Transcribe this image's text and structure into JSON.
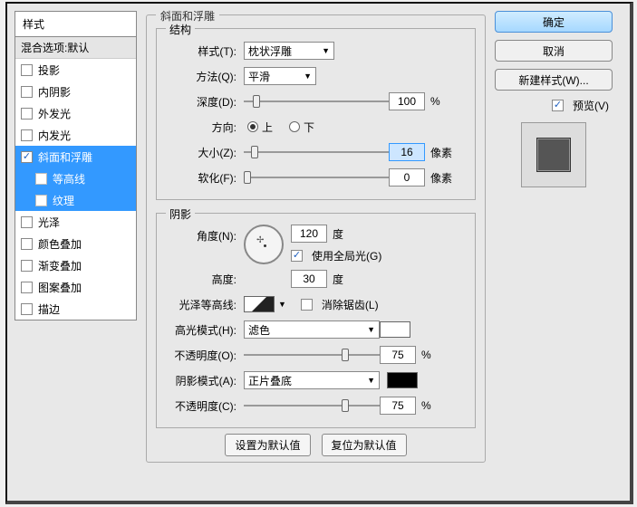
{
  "left": {
    "header": "样式",
    "blend_options": "混合选项:默认",
    "items": [
      {
        "label": "投影",
        "checked": false
      },
      {
        "label": "内阴影",
        "checked": false
      },
      {
        "label": "外发光",
        "checked": false
      },
      {
        "label": "内发光",
        "checked": false
      },
      {
        "label": "斜面和浮雕",
        "checked": true,
        "selected": true
      },
      {
        "label": "等高线",
        "checked": false,
        "selected": true,
        "sub": true
      },
      {
        "label": "纹理",
        "checked": false,
        "selected": true,
        "sub": true
      },
      {
        "label": "光泽",
        "checked": false
      },
      {
        "label": "颜色叠加",
        "checked": false
      },
      {
        "label": "渐变叠加",
        "checked": false
      },
      {
        "label": "图案叠加",
        "checked": false
      },
      {
        "label": "描边",
        "checked": false
      }
    ]
  },
  "mid": {
    "title": "斜面和浮雕",
    "structure": {
      "legend": "结构",
      "style_label": "样式(T):",
      "style_value": "枕状浮雕",
      "method_label": "方法(Q):",
      "method_value": "平滑",
      "depth_label": "深度(D):",
      "depth_value": "100",
      "depth_unit": "%",
      "direction_label": "方向:",
      "dir_up": "上",
      "dir_down": "下",
      "size_label": "大小(Z):",
      "size_value": "16",
      "size_unit": "像素",
      "soften_label": "软化(F):",
      "soften_value": "0",
      "soften_unit": "像素"
    },
    "shading": {
      "legend": "阴影",
      "angle_label": "角度(N):",
      "angle_value": "120",
      "angle_unit": "度",
      "global_light": "使用全局光(G)",
      "altitude_label": "高度:",
      "altitude_value": "30",
      "altitude_unit": "度",
      "contour_label": "光泽等高线:",
      "antialias": "消除锯齿(L)",
      "highlight_mode_label": "高光模式(H):",
      "highlight_mode_value": "滤色",
      "highlight_color": "#ffffff",
      "highlight_opacity_label": "不透明度(O):",
      "highlight_opacity_value": "75",
      "highlight_opacity_unit": "%",
      "shadow_mode_label": "阴影模式(A):",
      "shadow_mode_value": "正片叠底",
      "shadow_color": "#000000",
      "shadow_opacity_label": "不透明度(C):",
      "shadow_opacity_value": "75",
      "shadow_opacity_unit": "%"
    },
    "buttons": {
      "set_default": "设置为默认值",
      "reset_default": "复位为默认值"
    }
  },
  "right": {
    "ok": "确定",
    "cancel": "取消",
    "new_style": "新建样式(W)...",
    "preview": "预览(V)"
  }
}
